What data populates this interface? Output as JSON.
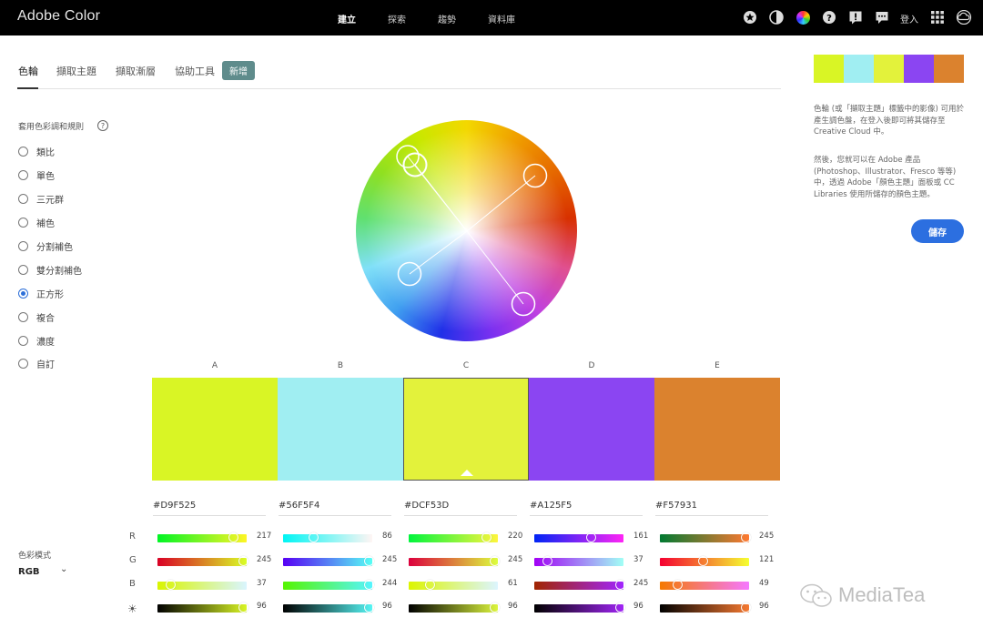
{
  "app": {
    "title": "Adobe Color",
    "signin": "登入"
  },
  "topnav": [
    "建立",
    "探索",
    "趨勢",
    "資料庫"
  ],
  "tabs": [
    {
      "label": "色輪"
    },
    {
      "label": "擷取主題"
    },
    {
      "label": "擷取漸層"
    },
    {
      "label": "協助工具"
    }
  ],
  "new_label": "新增",
  "rules": {
    "title": "套用色彩調和規則",
    "help": "?",
    "items": [
      "類比",
      "單色",
      "三元群",
      "補色",
      "分割補色",
      "雙分割補色",
      "正方形",
      "複合",
      "濃度",
      "自訂"
    ],
    "selected": "正方形"
  },
  "color_mode": {
    "label": "色彩模式",
    "value": "RGB"
  },
  "swatches": [
    {
      "letter": "A",
      "hex": "#D9F525",
      "color": "#D9F525",
      "r": 217,
      "g": 245,
      "b": 37,
      "bright": 96
    },
    {
      "letter": "B",
      "hex": "#56F5F4",
      "color": "#A0EEF2",
      "r": 86,
      "g": 245,
      "b": 244,
      "bright": 96
    },
    {
      "letter": "C",
      "hex": "#DCF53D",
      "color": "#E3F23B",
      "r": 220,
      "g": 245,
      "b": 61,
      "bright": 96
    },
    {
      "letter": "D",
      "hex": "#A125F5",
      "color": "#8B45F2",
      "r": 161,
      "g": 37,
      "b": 245,
      "bright": 96
    },
    {
      "letter": "E",
      "hex": "#F57931",
      "color": "#DB822E",
      "r": 245,
      "g": 121,
      "b": 49,
      "bright": 96
    }
  ],
  "channels": [
    "R",
    "G",
    "B",
    "☀"
  ],
  "panel": {
    "description_1": "色輪 (或「擷取主題」標籤中的影像) 可用於產生調色盤，在登入後即可將其儲存至 Creative Cloud 中。",
    "description_2": "然後，您就可以在 Adobe 產品 (Photoshop、Illustrator、Fresco 等等) 中，透過 Adobe「顏色主題」面板或 CC Libraries 使用所儲存的顏色主題。",
    "save": "儲存"
  },
  "watermark": "MediaTea"
}
